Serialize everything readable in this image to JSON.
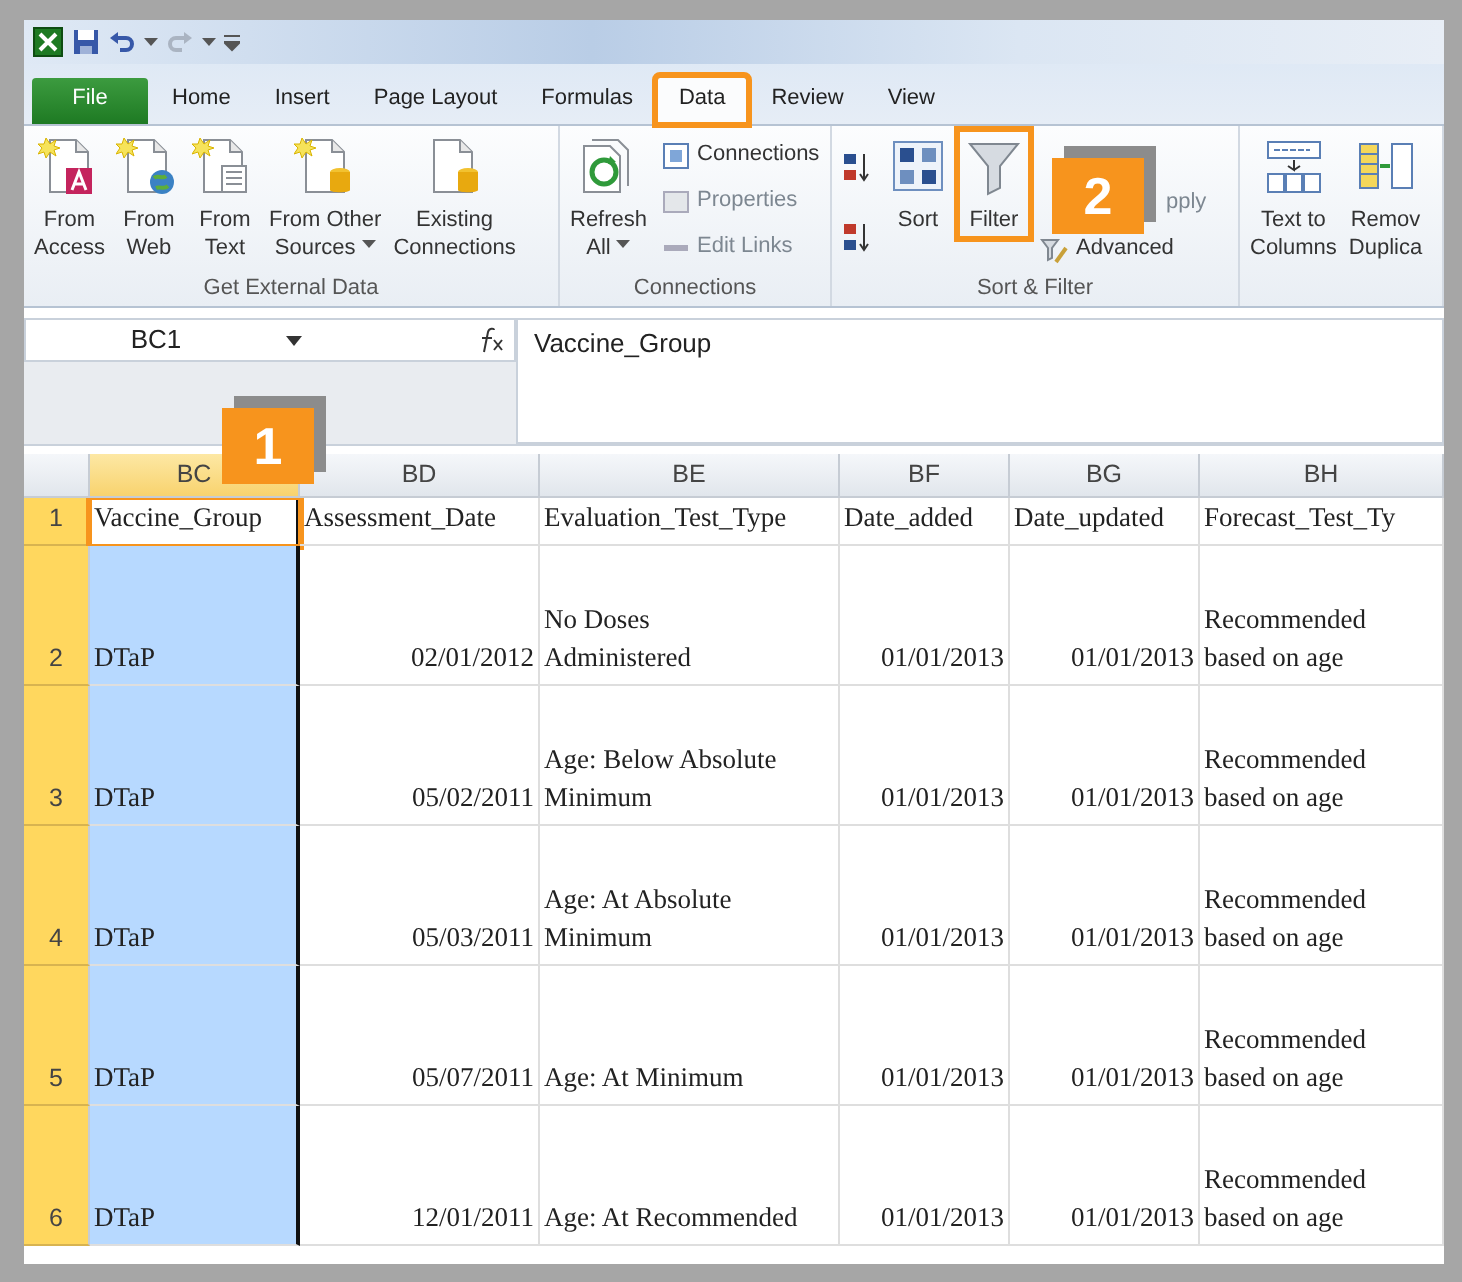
{
  "ribbon_tabs": [
    {
      "label": "File",
      "kind": "file",
      "selected": false,
      "highlighted": false
    },
    {
      "label": "Home",
      "kind": "tab",
      "selected": false,
      "highlighted": false
    },
    {
      "label": "Insert",
      "kind": "tab",
      "selected": false,
      "highlighted": false
    },
    {
      "label": "Page Layout",
      "kind": "tab",
      "selected": false,
      "highlighted": false
    },
    {
      "label": "Formulas",
      "kind": "tab",
      "selected": false,
      "highlighted": false
    },
    {
      "label": "Data",
      "kind": "tab",
      "selected": true,
      "highlighted": true
    },
    {
      "label": "Review",
      "kind": "tab",
      "selected": false,
      "highlighted": false
    },
    {
      "label": "View",
      "kind": "tab",
      "selected": false,
      "highlighted": false
    }
  ],
  "ribbon_groups": [
    {
      "label": "Get External Data",
      "items": [
        {
          "kind": "large",
          "lines": [
            "From",
            "Access"
          ]
        },
        {
          "kind": "large",
          "lines": [
            "From",
            "Web"
          ]
        },
        {
          "kind": "large",
          "lines": [
            "From",
            "Text"
          ]
        },
        {
          "kind": "large",
          "lines": [
            "From Other",
            "Sources"
          ],
          "dropdown": true
        },
        {
          "kind": "large",
          "lines": [
            "Existing",
            "Connections"
          ]
        }
      ]
    },
    {
      "label": "Connections",
      "items": [
        {
          "kind": "large",
          "lines": [
            "Refresh",
            "All"
          ],
          "dropdown": true
        },
        {
          "kind": "stack",
          "items": [
            {
              "label": "Connections",
              "disabled": false
            },
            {
              "label": "Properties",
              "disabled": true
            },
            {
              "label": "Edit Links",
              "disabled": true
            }
          ]
        }
      ]
    },
    {
      "label": "Sort & Filter",
      "items": [
        {
          "kind": "icon_stack"
        },
        {
          "kind": "large",
          "lines": [
            "Sort"
          ]
        },
        {
          "kind": "large",
          "lines": [
            "Filter"
          ],
          "highlighted": true,
          "callout": "2"
        },
        {
          "kind": "stack",
          "items": [
            {
              "label": "pply",
              "disabled": true
            },
            {
              "label": "Advanced",
              "disabled": false
            }
          ]
        }
      ]
    },
    {
      "items": [
        {
          "kind": "large",
          "lines": [
            "Text to",
            "Columns"
          ]
        },
        {
          "kind": "large",
          "lines": [
            "Remov",
            "Duplica"
          ]
        }
      ]
    }
  ],
  "name_box": "BC1",
  "formula": "Vaccine_Group",
  "columns": [
    {
      "label": "BC",
      "kind": "text",
      "selected": true,
      "callout": "1",
      "header_cell_highlighted": true
    },
    {
      "label": "BD",
      "kind": "date",
      "selected": false
    },
    {
      "label": "BE",
      "kind": "text",
      "selected": false
    },
    {
      "label": "BF",
      "kind": "date",
      "selected": false
    },
    {
      "label": "BG",
      "kind": "date",
      "selected": false
    },
    {
      "label": "BH",
      "kind": "text",
      "selected": false
    }
  ],
  "rows": [
    {
      "number": "1",
      "kind": "header",
      "cells": [
        "Vaccine_Group",
        "Assessment_Date",
        "Evaluation_Test_Type",
        "Date_added",
        "Date_updated",
        "Forecast_Test_Ty"
      ]
    },
    {
      "number": "2",
      "kind": "data",
      "cells": [
        "DTaP",
        "02/01/2012",
        "No Doses\nAdministered",
        "01/01/2013",
        "01/01/2013",
        "Recommended\nbased on age"
      ]
    },
    {
      "number": "3",
      "kind": "data",
      "cells": [
        "DTaP",
        "05/02/2011",
        "Age: Below Absolute\nMinimum",
        "01/01/2013",
        "01/01/2013",
        "Recommended\nbased on age"
      ]
    },
    {
      "number": "4",
      "kind": "data",
      "cells": [
        "DTaP",
        "05/03/2011",
        "Age: At Absolute\nMinimum",
        "01/01/2013",
        "01/01/2013",
        "Recommended\nbased on age"
      ]
    },
    {
      "number": "5",
      "kind": "data",
      "cells": [
        "DTaP",
        "05/07/2011",
        "Age: At Minimum",
        "01/01/2013",
        "01/01/2013",
        "Recommended\nbased on age"
      ]
    },
    {
      "number": "6",
      "kind": "data",
      "cells": [
        "DTaP",
        "12/01/2011",
        "Age: At Recommended",
        "01/01/2013",
        "01/01/2013",
        "Recommended\nbased on age"
      ]
    }
  ]
}
